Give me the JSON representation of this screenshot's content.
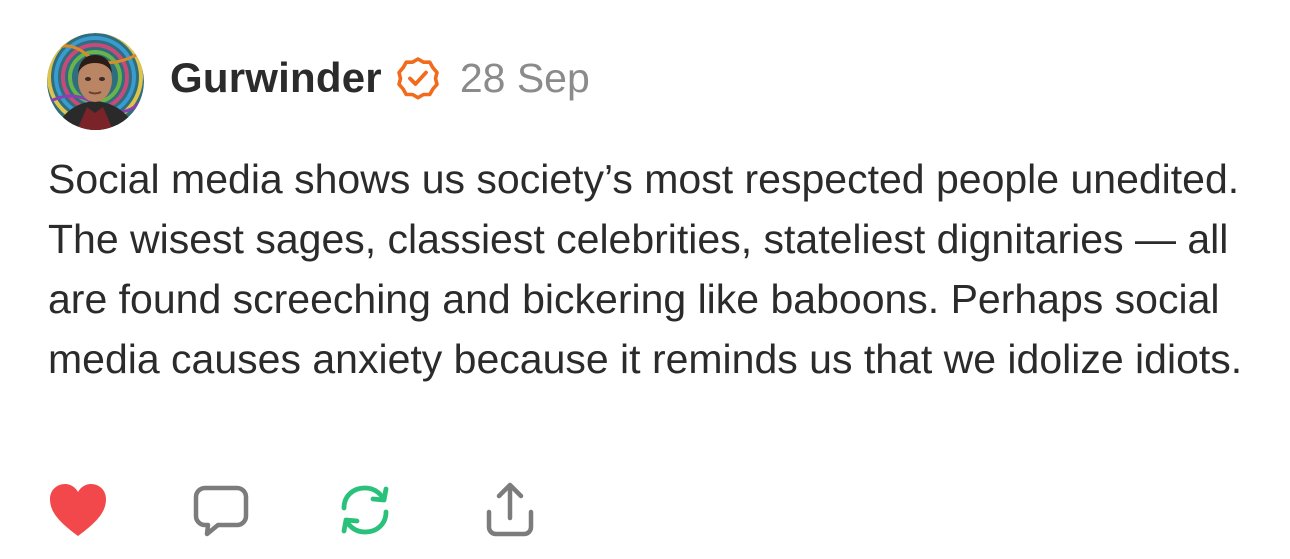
{
  "post": {
    "author": "Gurwinder",
    "date": "28 Sep",
    "text": "Social media shows us society’s most respected people unedited. The wisest sages, classiest celebrities, stateliest dignitaries — all are found screeching and bickering like baboons. Perhaps social media causes anxiety because it reminds us that we idolize idiots."
  },
  "icons": {
    "verified": "verified-badge-icon",
    "like": "heart-icon",
    "reply": "comment-bubble-icon",
    "repost": "repost-arrows-icon",
    "share": "share-upload-icon"
  },
  "colors": {
    "verified": "#F26A1B",
    "like": "#F2484B",
    "repost": "#2AC27A",
    "icon_gray": "#7C7C7C",
    "text": "#2B2B2B",
    "muted": "#8B8B8B"
  }
}
